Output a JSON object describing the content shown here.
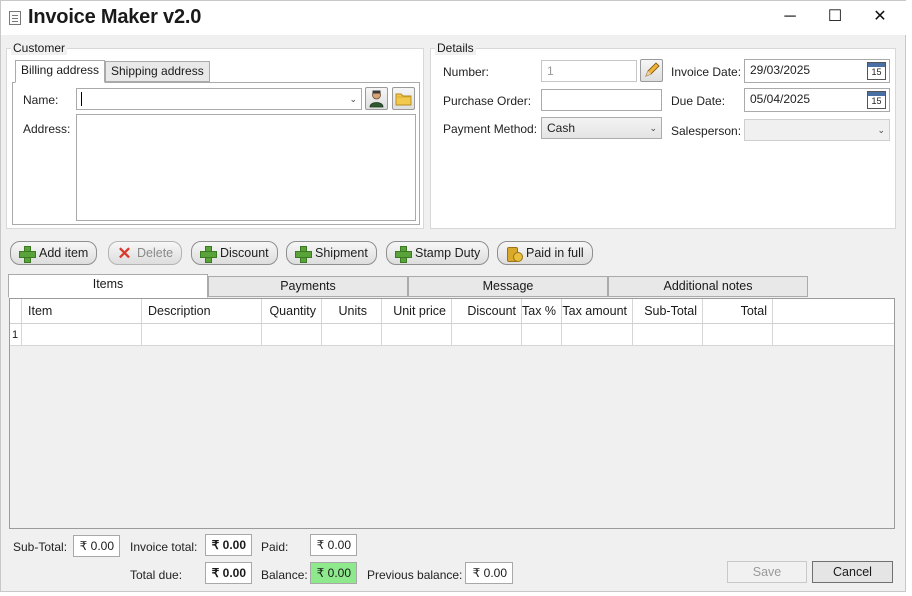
{
  "window": {
    "title": "Invoice Maker  v2.0",
    "minimize_icon": "minimize-icon",
    "maximize_icon": "maximize-icon",
    "close_icon": "close-icon"
  },
  "customer": {
    "legend": "Customer",
    "tabs": [
      "Billing address",
      "Shipping address"
    ],
    "name_label": "Name:",
    "name_value": "",
    "address_label": "Address:",
    "address_value": ""
  },
  "details": {
    "legend": "Details",
    "number_label": "Number:",
    "number_value": "1",
    "purchase_order_label": "Purchase Order:",
    "purchase_order_value": "",
    "payment_method_label": "Payment Method:",
    "payment_method_value": "Cash",
    "invoice_date_label": "Invoice Date:",
    "invoice_date_value": "29/03/2025",
    "due_date_label": "Due Date:",
    "due_date_value": "05/04/2025",
    "salesperson_label": "Salesperson:",
    "salesperson_value": "",
    "calendar_day": "15"
  },
  "toolbar": {
    "add_item": "Add item",
    "delete": "Delete",
    "discount": "Discount",
    "shipment": "Shipment",
    "stamp_duty": "Stamp Duty",
    "paid_in_full": "Paid in full"
  },
  "tabs": [
    "Items",
    "Payments",
    "Message",
    "Additional notes"
  ],
  "grid": {
    "columns": [
      "Item",
      "Description",
      "Quantity",
      "Units",
      "Unit price",
      "Discount",
      "Tax %",
      "Tax amount",
      "Sub-Total",
      "Total"
    ],
    "rows": [
      {
        "index": "1",
        "cells": [
          "",
          "",
          "",
          "",
          "",
          "",
          "",
          "",
          "",
          ""
        ]
      }
    ]
  },
  "totals": {
    "subtotal_label": "Sub-Total:",
    "subtotal_value": "₹ 0.00",
    "invoice_total_label": "Invoice total:",
    "invoice_total_value": "₹ 0.00",
    "paid_label": "Paid:",
    "paid_value": "₹ 0.00",
    "total_due_label": "Total due:",
    "total_due_value": "₹ 0.00",
    "balance_label": "Balance:",
    "balance_value": "₹ 0.00",
    "previous_balance_label": "Previous balance:",
    "previous_balance_value": "₹ 0.00"
  },
  "actions": {
    "save": "Save",
    "cancel": "Cancel"
  },
  "colors": {
    "balance_bg": "#8ee88c",
    "window_bg": "#f0f0f0"
  }
}
